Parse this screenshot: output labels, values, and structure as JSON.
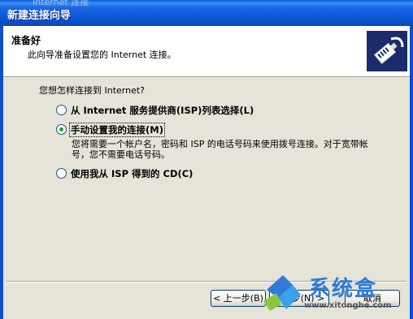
{
  "window": {
    "title": "新建连接向导",
    "background_text": "Internet 连接"
  },
  "header": {
    "title": "准备好",
    "subtitle": "此向导准备设置您的 Internet 连接。"
  },
  "content": {
    "question": "您想怎样连接到 Internet?",
    "options": [
      {
        "label": "从 Internet 服务提供商(ISP)列表选择(L)",
        "selected": false
      },
      {
        "label": "手动设置我的连接(M)",
        "selected": true
      },
      {
        "label": "使用我从 ISP 得到的 CD(C)",
        "selected": false
      }
    ],
    "option_description": "您将需要一个帐户名，密码和 ISP 的电话号码来使用拨号连接。对于宽带帐号，您不需要电话号码。"
  },
  "buttons": {
    "back": "< 上一步(B)",
    "next": "下一步(N) >",
    "cancel": "取消"
  },
  "watermark": {
    "text": "系统盒",
    "url": "www.xitonghe.com"
  },
  "colors": {
    "titlebar": "#0b54d3",
    "frame": "#0a4fcf",
    "dialog_bg": "#ece9d8",
    "radio_checked": "#20a020"
  },
  "icons": {
    "wizard": "network-plug-icon"
  }
}
